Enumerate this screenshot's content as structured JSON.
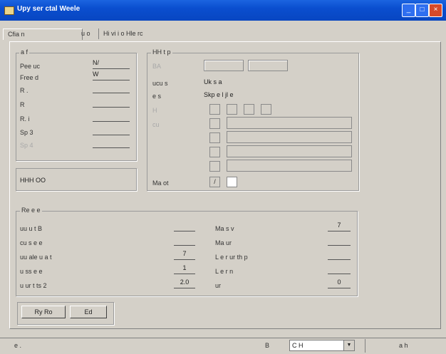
{
  "window": {
    "title": "Upy ser ctal Weele",
    "min_icon": "minimize-icon",
    "max_icon": "maximize-icon",
    "close_icon": "close-icon"
  },
  "tabs": [
    {
      "label": "Cfia n"
    },
    {
      "label": "u o"
    },
    {
      "label": "Hi vi i o Hle rc"
    }
  ],
  "info_group": {
    "title": "a f",
    "rows": [
      {
        "label": "Pee uc",
        "value": "N/"
      },
      {
        "label": "Free d",
        "value": "W"
      },
      {
        "label": "R .",
        "value": ""
      },
      {
        "label": "R",
        "value": ""
      },
      {
        "label": "R. i",
        "value": ""
      },
      {
        "label": "Sp 3",
        "value": ""
      },
      {
        "label": "Sp 4",
        "value": ""
      }
    ]
  },
  "sub_group": {
    "title": "",
    "value": "HHH OO"
  },
  "right_group": {
    "title": "HH t p",
    "rows": [
      {
        "label": "BA",
        "value": ""
      },
      {
        "label": "ucu s",
        "value": "Uk s a"
      },
      {
        "label": "e s",
        "value": "Skp e l jl e"
      },
      {
        "label": "H",
        "value": ""
      },
      {
        "label": "cu",
        "value": ""
      }
    ],
    "bottom_label": "Ma ot",
    "bottom_value": "/"
  },
  "stats_group": {
    "title": "Re e e",
    "left": [
      {
        "label": "uu u t B",
        "value": ""
      },
      {
        "label": "cu s e e ",
        "value": ""
      },
      {
        "label": "uu ale u a t",
        "value": "7"
      },
      {
        "label": "u ss e e",
        "value": "1"
      },
      {
        "label": "u ur t ts 2",
        "value": "2.0"
      }
    ],
    "right": [
      {
        "label": "Ma s v",
        "value": "7"
      },
      {
        "label": "Ma ur",
        "value": ""
      },
      {
        "label": "L e r ur th p",
        "value": ""
      },
      {
        "label": "L e r n ",
        "value": ""
      },
      {
        "label": "ur ",
        "value": "0"
      }
    ]
  },
  "buttons": {
    "apply": "Ry Ro",
    "close": "Ed"
  },
  "status": {
    "left": "e .",
    "label": "B ",
    "combo_value": "C H",
    "right": "a h"
  }
}
